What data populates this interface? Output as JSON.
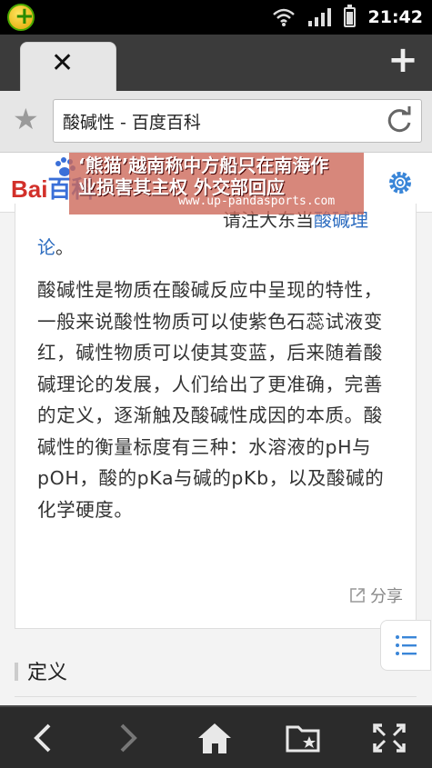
{
  "status_bar": {
    "time": "21:42",
    "icons": [
      "app-badge-icon",
      "wifi-icon",
      "signal-icon",
      "battery-icon"
    ]
  },
  "tabs": {
    "close_glyph": "✕",
    "new_tab_glyph": "+"
  },
  "address_bar": {
    "url_text": "酸碱性 - 百度百科"
  },
  "baidu_header": {
    "logo_bai": "Bai",
    "logo_du": "百科"
  },
  "ad_overlay": {
    "line1": "‘熊猫’越南称中方船只在南海作",
    "line2": "业损害其主权 外交部回应",
    "url": "www.up-pandasports.com"
  },
  "article": {
    "top_fragment_text": "请注大东当",
    "top_fragment_link": "酸碱理",
    "lun_text": "论",
    "lun_punct": "。",
    "paragraph": "酸碱性是物质在酸碱反应中呈现的特性，一般来说酸性物质可以使紫色石蕊试液变红，碱性物质可以使其变蓝，后来随着酸碱理论的发展，人们给出了更准确，完善的定义，逐渐触及酸碱性成因的本质。酸碱性的衡量标度有三种：水溶液的pH与pOH，酸的pKa与碱的pKb，以及酸碱的化学硬度。",
    "share_label": "分享"
  },
  "section": {
    "title": "定义"
  },
  "colors": {
    "link": "#2e6dc0",
    "baidu_red": "#d2302a",
    "baidu_blue": "#3a6fd8",
    "ad_bg": "#cd695a"
  }
}
